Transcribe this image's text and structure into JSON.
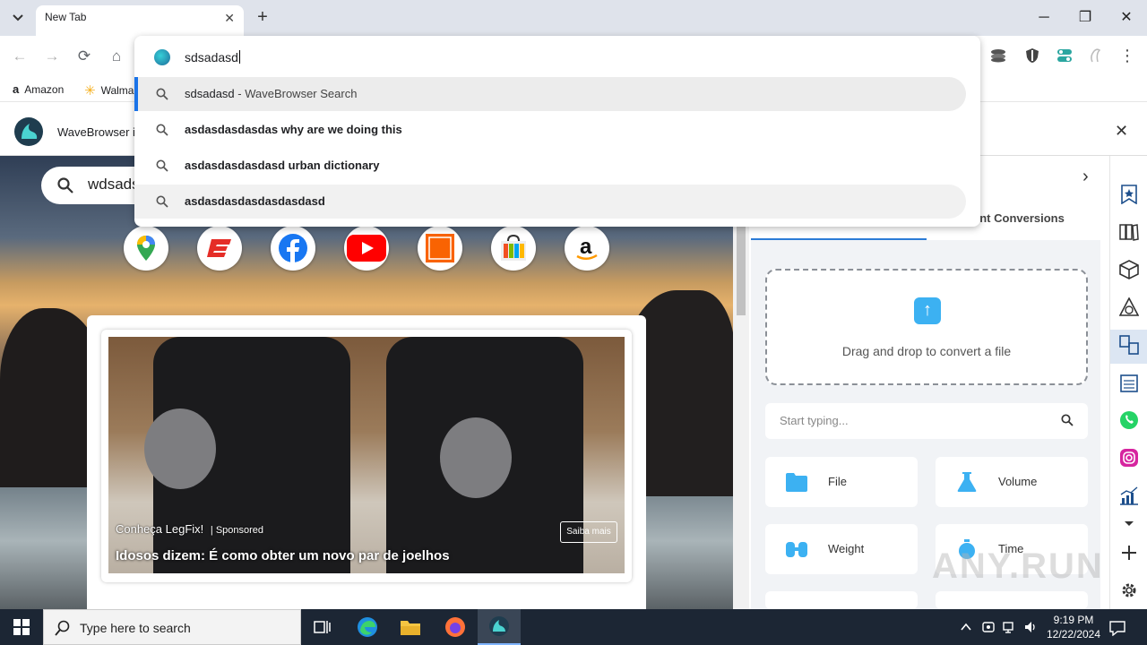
{
  "browser": {
    "tab": {
      "title": "New Tab",
      "close": "✕"
    },
    "new_tab": "+",
    "window": {
      "minimize": "─",
      "maximize": "❐",
      "close": "✕"
    }
  },
  "toolbar": {
    "back": "←",
    "forward": "→",
    "reload": "⟳",
    "home": "⌂",
    "menu": "⋮"
  },
  "bookmarks": [
    {
      "label": "Amazon",
      "icon": "amazon-icon"
    },
    {
      "label": "Walma",
      "icon": "walmart-icon"
    }
  ],
  "infobar": {
    "text": "WaveBrowser i",
    "close": "✕"
  },
  "omnibox": {
    "input_value": "sdsadasd",
    "suggestions": [
      {
        "plain": "sdsadasd",
        "suffix": " - WaveBrowser Search"
      },
      {
        "plain": "asdasdasdasdas",
        "bold": " why are we doing this"
      },
      {
        "plain": "asdasdasdasdasd",
        "bold": " urban dictionary"
      },
      {
        "plain": "asdasdasdasdasdasdasd",
        "bold": ""
      }
    ]
  },
  "page": {
    "search_value": "wdsads",
    "shortcuts": [
      "google-maps-icon",
      "espn-icon",
      "facebook-icon",
      "youtube-icon",
      "home-depot-icon",
      "microsoft-store-icon",
      "amazon-icon"
    ],
    "ad": {
      "brand": "Conheça LegFix!",
      "sponsored": "Sponsored",
      "title": "Idosos dizem: É como obter um novo par de joelhos",
      "cta": "Saiba mais"
    }
  },
  "sidepanel": {
    "tab_label": "ent Conversions",
    "chevron": "›",
    "dropzone_text": "Drag and drop to convert a file",
    "search_placeholder": "Start typing...",
    "conversions": [
      {
        "label": "File",
        "icon": "folder-icon"
      },
      {
        "label": "Volume",
        "icon": "beaker-icon"
      },
      {
        "label": "Weight",
        "icon": "weight-icon"
      },
      {
        "label": "Time",
        "icon": "stopwatch-icon"
      }
    ]
  },
  "rail_icons": [
    "bookmark-star-icon",
    "reading-list-icon",
    "box-icon",
    "shapes-icon",
    "converter-icon",
    "calendar-icon",
    "whatsapp-icon",
    "instagram-icon",
    "chart-icon",
    "chevron-down-icon",
    "add-icon",
    "settings-icon"
  ],
  "taskbar": {
    "search_placeholder": "Type here to search",
    "time": "9:19 PM",
    "date": "12/22/2024"
  },
  "watermark": "ANY.RUN",
  "colors": {
    "accent": "#1a73e8",
    "taskbar": "#1c2634"
  }
}
